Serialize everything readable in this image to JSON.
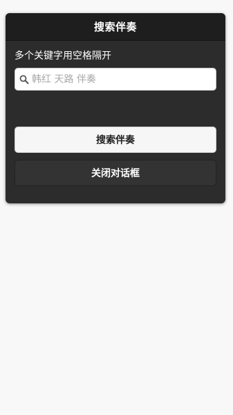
{
  "dialog": {
    "title": "搜索伴奏",
    "hint": "多个关键字用空格隔开",
    "search": {
      "placeholder": "韩红 天路 伴奏",
      "value": "",
      "icon": "search-icon"
    },
    "search_button_label": "搜索伴奏",
    "close_button_label": "关闭对话框"
  },
  "colors": {
    "dialog_bg": "#2c2c2c",
    "header_bg": "#1e1e1e",
    "page_bg": "#f8f8f8",
    "primary_button_bg": "#f6f6f6",
    "secondary_button_bg": "#333333"
  }
}
